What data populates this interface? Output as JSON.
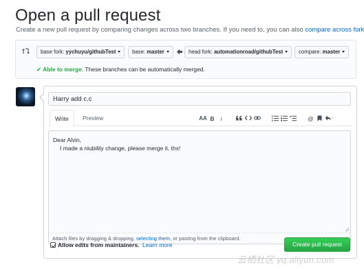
{
  "page": {
    "title": "Open a pull request",
    "subtitle_text": "Create a new pull request by comparing changes across two branches. If you need to, you can also ",
    "subtitle_link": "compare across forks."
  },
  "compare": {
    "base_fork_prefix": "base fork: ",
    "base_fork_value": "yychuyu/githubTest",
    "base_prefix": "base: ",
    "base_value": "master",
    "head_fork_prefix": "head fork: ",
    "head_fork_value": "automationroad/githubTest",
    "compare_prefix": "compare: ",
    "compare_value": "master",
    "merge_status_ok": "✔ Able to merge.",
    "merge_status_text": " These branches can be automatically merged."
  },
  "form": {
    "title_value": "Harry add c.c",
    "tabs": [
      "Write",
      "Preview"
    ],
    "toolbar": {
      "header": "AA",
      "bold": "B",
      "italic": "i"
    },
    "body_line1": "Dear Alvin,",
    "body_line2": "I made a niubility change, please merge it, thx!",
    "attach_text_1": "Attach files by dragging & dropping, ",
    "attach_link": "selecting them",
    "attach_text_2": ", or pasting from the clipboard.",
    "allow_edits_label": "Allow edits from maintainers.",
    "learn_more": "Learn more",
    "submit_label": "Create pull request"
  },
  "watermark": "云栖社区 yq.aliyun.com",
  "colors": {
    "link": "#0366d6",
    "success": "#28a745",
    "border": "#d1d5da"
  }
}
